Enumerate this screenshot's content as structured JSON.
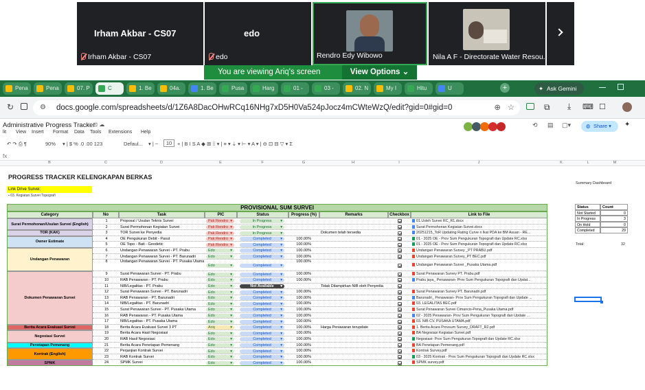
{
  "meet": {
    "participants": [
      {
        "big": "Irham Akbar - CS07",
        "name": "Irham Akbar - CS07",
        "muted": true
      },
      {
        "big": "edo",
        "name": "edo",
        "muted": true
      },
      {
        "big": "",
        "name": "Rendro Edy Wibowo",
        "muted": false
      },
      {
        "big": "",
        "name": "Nila A F - Directorate Water Resou...",
        "muted": false
      }
    ],
    "next_icon": "chevron-right-icon",
    "banner_text": "You are viewing  Ariq's screen",
    "view_options": "View Options"
  },
  "browser": {
    "tabs": [
      "Pena",
      "Pena",
      "07. P",
      "C",
      "1. Be",
      "04a.",
      "1. Be",
      "Pusa",
      "Harg",
      "01 -",
      "03 -",
      "02. N",
      "My I",
      "Hitu",
      "U"
    ],
    "ask_gemini": "Ask Gemini",
    "url": "docs.google.com/spreadsheets/d/1Z6A8DacOHwRCq16NHg7xD5H0Va524pJocz4mCWteWzQ/edit?gid=0#gid=0"
  },
  "doc": {
    "title": "Administrative Progress Tracker",
    "menu": [
      "lit",
      "View",
      "Insert",
      "Format",
      "Data",
      "Tools",
      "Extensions",
      "Help"
    ],
    "share": "Share",
    "zoom": "90%",
    "font": "Defaul...",
    "font_size": "10",
    "fx": "fx",
    "columns": [
      "B",
      "C",
      "D",
      "E",
      "F",
      "G",
      "H",
      "I",
      "J",
      "K",
      "L",
      "M"
    ]
  },
  "sheet": {
    "title": "PROGRESS TRACKER KELENGKAPAN BERKAS",
    "link_drive_label": "Link Drive Survei:",
    "link_drive_value": "03. Kegiatan Survei Topografi",
    "table_title": "PROVISIONAL SUM SURVEI",
    "headers": [
      "Category",
      "No",
      "Task",
      "PIC",
      "Status",
      "Progress (%)",
      "Remarks",
      "Checkbox",
      "Link to File"
    ],
    "categories": [
      {
        "label": "Surat Permohonan/Usulan Survei (English)",
        "color": "#d9d2e9"
      },
      {
        "label": "TOR (KAK)",
        "color": "#d9d2e9"
      },
      {
        "label": "Owner Estimate",
        "color": "#cfe2f3"
      },
      {
        "label": "Undangan Penawaran",
        "color": "#fff2cc"
      },
      {
        "label": "Dokumen Penawaran Survei",
        "color": "#f4cccc"
      },
      {
        "label": "Berita Acara Evaluasi Survei",
        "color": "#e06666"
      },
      {
        "label": "Negosiasi Survei",
        "color": "#f4cccc"
      },
      {
        "label": "Penetapan Pemenang",
        "color": "#00ffff"
      },
      {
        "label": "Kontrak (English)",
        "color": "#ff9900"
      },
      {
        "label": "SPMK",
        "color": "#c27ba0"
      }
    ],
    "rows": [
      {
        "no": "1",
        "task": "Proposal / Usulan Teknis Survei",
        "pic": "Pak Rendro",
        "status": "In Progress",
        "progress": "",
        "remarks": "",
        "link": "01.Usleh Survei RC_R1.docx"
      },
      {
        "no": "2",
        "task": "Surat Permohonan Kegiatan Survei",
        "pic": "Pak Rendro",
        "status": "In Progress",
        "progress": "",
        "remarks": "",
        "link": "Surat Permohonan Kegiatan Survei.docx"
      },
      {
        "no": "3",
        "task": "TOR Survei ke Penyedia",
        "pic": "Pak Rendro",
        "status": "In Progress",
        "progress": "",
        "remarks": "Dokumen telah tersedia",
        "link": "20251215_ToR Updating Rating Curve n lkat PDA ke BM Asuan - RE..."
      },
      {
        "no": "4",
        "task": "OE Pengukuran Debit - Pasut",
        "pic": "Pak Rendro",
        "status": "Completed",
        "progress": "100.00%",
        "remarks": "",
        "link": "01 - 2025 OE - Prov Sum Pengukuran Topografi dan Update RC.xlsx"
      },
      {
        "no": "5",
        "task": "OE Topo - Bati - Geodetic",
        "pic": "Pak Rendro",
        "status": "Completed",
        "progress": "100.00%",
        "remarks": "",
        "link": "01 - 2025 OE - Prov Sum Pengukuran Topografi dan Update RC.xlsx"
      },
      {
        "no": "6",
        "task": "Undangan Penawaran Survei - PT. Prabu",
        "pic": "Edo",
        "status": "Completed",
        "progress": "100.00%",
        "remarks": "",
        "link": "Undangan Penawaran Survey _PT PRABU.pdf"
      },
      {
        "no": "7",
        "task": "Undangan Penawaran Survei - PT. Barunadri",
        "pic": "Edo",
        "status": "Completed",
        "progress": "100.00%",
        "remarks": "",
        "link": "Undangan Penawaran Survey_PT BEC.pdf"
      },
      {
        "no": "8",
        "task": "Undangan Penawaran Survei - PT. Pusaka Utama",
        "pic": "Edo",
        "status": "Completed",
        "progress": "100.00%",
        "remarks": "",
        "link": "Undangan Penawaran Survei _Pusaka Utama.pdf"
      },
      {
        "no": "9",
        "task": "Surat Penawaran Survei - PT. Prabu",
        "pic": "Edo",
        "status": "Completed",
        "progress": "100.00%",
        "remarks": "",
        "link": "Surat Penawaran Survey PT. Prabu.pdf"
      },
      {
        "no": "10",
        "task": "RAB Penawaran - PT. Prabu",
        "pic": "Edo",
        "status": "Completed",
        "progress": "100.00%",
        "remarks": "",
        "link": "Prabu jaya_ Penawaran- Prov Sum Pengukuran Topografi dan Updat..."
      },
      {
        "no": "11",
        "task": "NIB/Legalitas - PT. Prabu",
        "pic": "Edo",
        "status": "Not Available",
        "progress": "",
        "remarks": "Tidak Dilampirkan NIB oleh Penyedia",
        "link": ""
      },
      {
        "no": "12",
        "task": "Surat Penawaran Survei - PT. Barunadri",
        "pic": "Edo",
        "status": "Completed",
        "progress": "100.00%",
        "remarks": "",
        "link": "Surat Penawaran Survey PT. Barunadri.pdf"
      },
      {
        "no": "13",
        "task": "RAB Penawaran - PT. Barunadri",
        "pic": "Edo",
        "status": "Completed",
        "progress": "100.00%",
        "remarks": "",
        "link": "Barunadri_ Penawaran- Prov Sum Pengukuran Topografi dan Update ..."
      },
      {
        "no": "14",
        "task": "NIB/Legalitas - PT. Barunadri",
        "pic": "Edo",
        "status": "Completed",
        "progress": "100.00%",
        "remarks": "",
        "link": "03. LEGALITAS BEC.pdf"
      },
      {
        "no": "15",
        "task": "Surat Penawaran Survei - PT. Pusaka Utama",
        "pic": "Edo",
        "status": "Completed",
        "progress": "100.00%",
        "remarks": "",
        "link": "Surat Penawaran Survei Cimancis-Pena_Pusaka Utama.pdf"
      },
      {
        "no": "16",
        "task": "RAB Penawaran - PT. Pusaka Utama",
        "pic": "Edo",
        "status": "Completed",
        "progress": "100.00%",
        "remarks": "",
        "link": "02 - 2025 Penawaran- Prov Sum Pengukuran Topografi dan Update ..."
      },
      {
        "no": "17",
        "task": "NIB/Legalitas - PT. Pusaka Utama",
        "pic": "Edo",
        "status": "Completed",
        "progress": "100.00%",
        "remarks": "",
        "link": "03. NIB CV. PUSAKA UTAMA.pdf"
      },
      {
        "no": "18",
        "task": "Berita Acara Evaluasi Survei 3 PT",
        "pic": "Ariq",
        "status": "Completed",
        "progress": "100.00%",
        "remarks": "Harga Penawaran terupdate",
        "link": "1. Berita Acara Provsum Survey_DRAFT_R2.pdf"
      },
      {
        "no": "19",
        "task": "Berita Acara Hasil Negosiasi",
        "pic": "Edo",
        "status": "Completed",
        "progress": "100.00%",
        "remarks": "",
        "link": "BA Negosiasi Kegiatan Survei.pdf"
      },
      {
        "no": "20",
        "task": "RAB Hasil Negosiasi",
        "pic": "Edo",
        "status": "Completed",
        "progress": "100.00%",
        "remarks": "",
        "link": "Negosiasi- Prov Sum Pengukuran Topografi dan Update RC.xlsx"
      },
      {
        "no": "21",
        "task": "Berita Acara Penetapan Pemenang",
        "pic": "Edo",
        "status": "Completed",
        "progress": "100.00%",
        "remarks": "",
        "link": "BA Penetapan Pemenang.pdf"
      },
      {
        "no": "22",
        "task": "Perjanjian Kontrak Survei",
        "pic": "Edo",
        "status": "Completed",
        "progress": "100.00%",
        "remarks": "",
        "link": "Kontrak Survey.pdf"
      },
      {
        "no": "23",
        "task": "RAB Kontrak Survei",
        "pic": "Edo",
        "status": "Completed",
        "progress": "100.00%",
        "remarks": "",
        "link": "03 - 2025 Kontrak - Prov Sum Pengukuran Topografi dan Update RC.xlsx"
      },
      {
        "no": "24",
        "task": "SPMK Survei",
        "pic": "Edo",
        "status": "Completed",
        "progress": "100.00%",
        "remarks": "",
        "link": "SPMK survey.pdf"
      }
    ],
    "summary": {
      "title": "Summary Dashboard",
      "headers": [
        "Status",
        "Count"
      ],
      "rows": [
        {
          "status": "Not Started",
          "count": "0"
        },
        {
          "status": "In Progress",
          "count": "3"
        },
        {
          "status": "On Hold",
          "count": "0"
        },
        {
          "status": "Completed",
          "count": "29"
        }
      ],
      "total_label": "Total:",
      "total": "32"
    }
  },
  "colors": {
    "pic_rendro": "#f4c7c3",
    "pic_edo": "#d9ead3",
    "pic_ariq": "#fce8b2",
    "status_progress": "#d9ead3",
    "status_completed": "#c9daf8",
    "status_na": "#434343",
    "table_title_bg": "#b6d7a8",
    "header_bg": "#d9ead3"
  }
}
